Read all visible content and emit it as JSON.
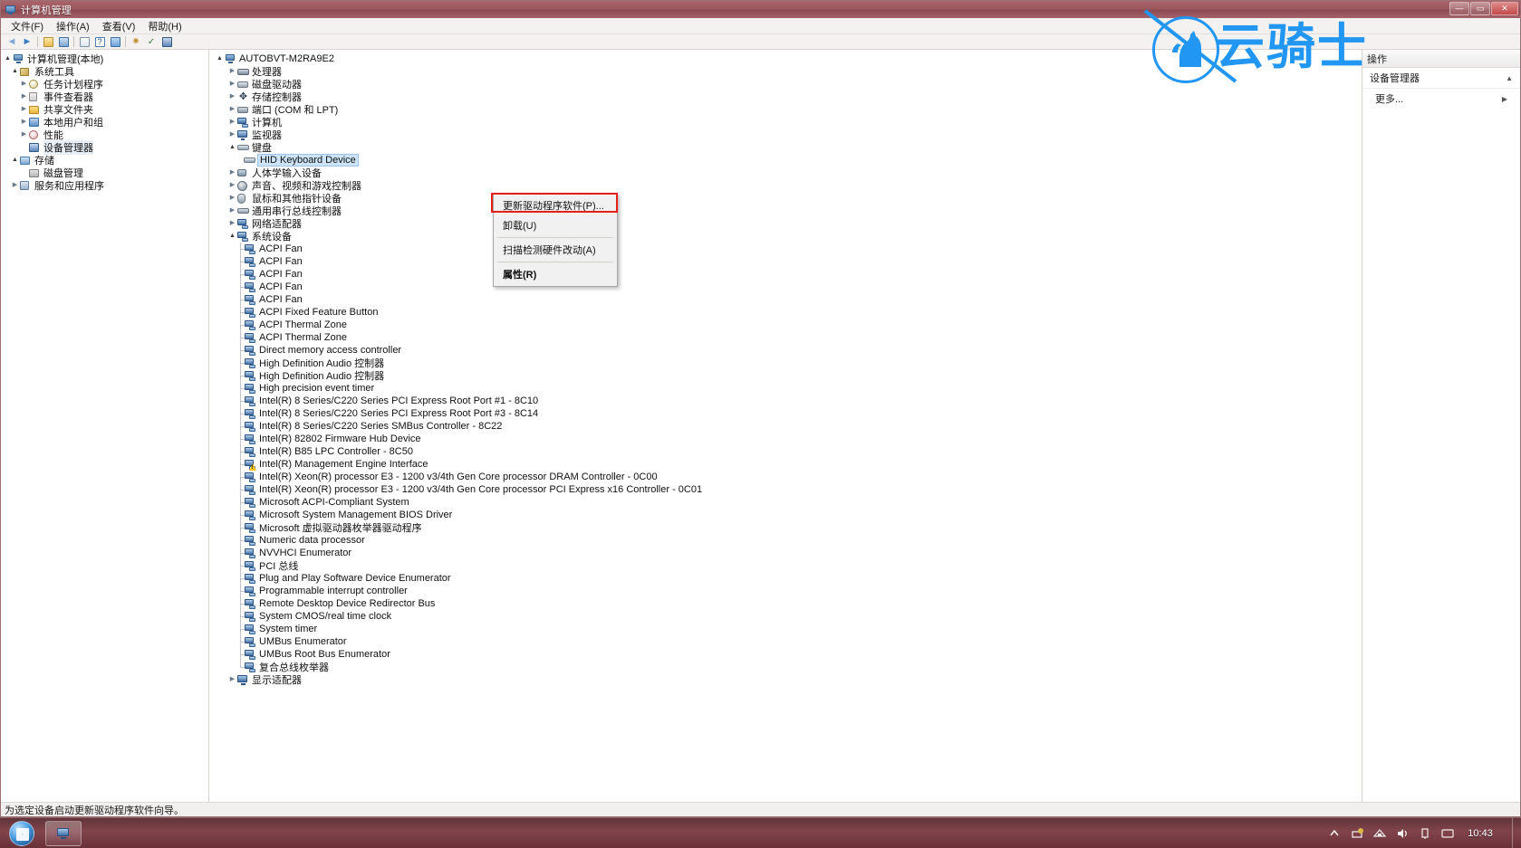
{
  "window": {
    "title": "计算机管理",
    "icon": "computer-management-icon",
    "controls": {
      "minimize": "—",
      "maximize": "▭",
      "close": "✕"
    }
  },
  "menu_bar": {
    "items": [
      {
        "label": "文件(F)",
        "name": "menu-file"
      },
      {
        "label": "操作(A)",
        "name": "menu-action"
      },
      {
        "label": "查看(V)",
        "name": "menu-view"
      },
      {
        "label": "帮助(H)",
        "name": "menu-help"
      }
    ]
  },
  "toolbar": {
    "buttons": [
      {
        "name": "back-button",
        "icon": "arrow-left-icon",
        "glyph": "◄"
      },
      {
        "name": "forward-button",
        "icon": "arrow-right-icon",
        "glyph": "►"
      },
      {
        "name": "up-one-level-button",
        "icon": "folder-up-icon",
        "glyph": ""
      },
      {
        "name": "show-hide-tree-button",
        "icon": "tree-pane-icon",
        "glyph": ""
      },
      {
        "name": "export-list-button",
        "icon": "export-list-icon",
        "glyph": ""
      },
      {
        "name": "help-button",
        "icon": "question-icon",
        "glyph": "?"
      },
      {
        "name": "properties-button",
        "icon": "properties-icon",
        "glyph": ""
      },
      {
        "name": "refresh-button",
        "icon": "refresh-icon",
        "glyph": ""
      },
      {
        "name": "scan-hardware-button",
        "icon": "scan-hardware-icon",
        "glyph": ""
      },
      {
        "name": "update-driver-button",
        "icon": "update-driver-icon",
        "glyph": ""
      }
    ]
  },
  "left_tree": {
    "items": [
      {
        "label": "计算机管理(本地)",
        "indent": 0,
        "twisty": "▲",
        "icon": "computer-icon"
      },
      {
        "label": "系统工具",
        "indent": 1,
        "twisty": "▲",
        "icon": "tools-icon"
      },
      {
        "label": "任务计划程序",
        "indent": 2,
        "twisty": "▶",
        "icon": "task-scheduler-icon"
      },
      {
        "label": "事件查看器",
        "indent": 2,
        "twisty": "▶",
        "icon": "event-viewer-icon"
      },
      {
        "label": "共享文件夹",
        "indent": 2,
        "twisty": "▶",
        "icon": "shared-folders-icon"
      },
      {
        "label": "本地用户和组",
        "indent": 2,
        "twisty": "▶",
        "icon": "local-users-groups-icon"
      },
      {
        "label": "性能",
        "indent": 2,
        "twisty": "▶",
        "icon": "performance-icon"
      },
      {
        "label": "设备管理器",
        "indent": 2,
        "twisty": "",
        "icon": "device-manager-icon",
        "selected": true
      },
      {
        "label": "存储",
        "indent": 1,
        "twisty": "▲",
        "icon": "storage-icon"
      },
      {
        "label": "磁盘管理",
        "indent": 2,
        "twisty": "",
        "icon": "disk-management-icon"
      },
      {
        "label": "服务和应用程序",
        "indent": 1,
        "twisty": "▶",
        "icon": "services-apps-icon"
      }
    ]
  },
  "device_tree": {
    "root": {
      "label": "AUTOBVT-M2RA9E2",
      "twisty": "▲",
      "icon": "computer-icon"
    },
    "categories": [
      {
        "label": "处理器",
        "twisty": "▶",
        "icon": "processor-icon"
      },
      {
        "label": "磁盘驱动器",
        "twisty": "▶",
        "icon": "disk-drive-icon"
      },
      {
        "label": "存储控制器",
        "twisty": "▶",
        "icon": "storage-controller-icon"
      },
      {
        "label": "端口 (COM 和 LPT)",
        "twisty": "▶",
        "icon": "ports-icon"
      },
      {
        "label": "计算机",
        "twisty": "▶",
        "icon": "computer-category-icon"
      },
      {
        "label": "监视器",
        "twisty": "▶",
        "icon": "monitor-icon"
      },
      {
        "label": "键盘",
        "twisty": "▲",
        "icon": "keyboard-icon"
      }
    ],
    "keyboard_child": {
      "label": "HID Keyboard Device",
      "icon": "hid-keyboard-icon",
      "selected": true
    },
    "categories_after": [
      {
        "label": "人体学输入设备",
        "twisty": "▶",
        "icon": "hid-icon"
      },
      {
        "label": "声音、视频和游戏控制器",
        "twisty": "▶",
        "icon": "sound-icon"
      },
      {
        "label": "鼠标和其他指针设备",
        "twisty": "▶",
        "icon": "mouse-icon"
      },
      {
        "label": "通用串行总线控制器",
        "twisty": "▶",
        "icon": "usb-icon"
      },
      {
        "label": "网络适配器",
        "twisty": "▶",
        "icon": "network-adapter-icon"
      }
    ],
    "system_devices_label": "系统设备",
    "system_devices_twisty": "▲",
    "system_devices": [
      {
        "label": "ACPI Fan"
      },
      {
        "label": "ACPI Fan"
      },
      {
        "label": "ACPI Fan"
      },
      {
        "label": "ACPI Fan"
      },
      {
        "label": "ACPI Fan"
      },
      {
        "label": "ACPI Fixed Feature Button"
      },
      {
        "label": "ACPI Thermal Zone"
      },
      {
        "label": "ACPI Thermal Zone"
      },
      {
        "label": "Direct memory access controller"
      },
      {
        "label": "High Definition Audio 控制器"
      },
      {
        "label": "High Definition Audio 控制器"
      },
      {
        "label": "High precision event timer"
      },
      {
        "label": "Intel(R) 8 Series/C220 Series PCI Express Root Port #1 - 8C10"
      },
      {
        "label": "Intel(R) 8 Series/C220 Series PCI Express Root Port #3 - 8C14"
      },
      {
        "label": "Intel(R) 8 Series/C220 Series SMBus Controller - 8C22"
      },
      {
        "label": "Intel(R) 82802 Firmware Hub Device"
      },
      {
        "label": "Intel(R) B85 LPC Controller - 8C50"
      },
      {
        "label": "Intel(R) Management Engine Interface",
        "warning": true
      },
      {
        "label": "Intel(R) Xeon(R) processor E3 - 1200 v3/4th Gen Core processor DRAM Controller - 0C00"
      },
      {
        "label": "Intel(R) Xeon(R) processor E3 - 1200 v3/4th Gen Core processor PCI Express x16 Controller - 0C01"
      },
      {
        "label": "Microsoft ACPI-Compliant System"
      },
      {
        "label": "Microsoft System Management BIOS Driver"
      },
      {
        "label": "Microsoft 虚拟驱动器枚举器驱动程序"
      },
      {
        "label": "Numeric data processor"
      },
      {
        "label": "NVVHCI Enumerator"
      },
      {
        "label": "PCI 总线"
      },
      {
        "label": "Plug and Play Software Device Enumerator"
      },
      {
        "label": "Programmable interrupt controller"
      },
      {
        "label": "Remote Desktop Device Redirector Bus"
      },
      {
        "label": "System CMOS/real time clock"
      },
      {
        "label": "System timer"
      },
      {
        "label": "UMBus Enumerator"
      },
      {
        "label": "UMBus Root Bus Enumerator"
      },
      {
        "label": "复合总线枚举器"
      }
    ],
    "trailing_category": {
      "label": "显示适配器",
      "twisty": "▶",
      "icon": "display-adapter-icon"
    }
  },
  "context_menu": {
    "items": [
      {
        "label": "更新驱动程序软件(P)...",
        "name": "menu-update-driver",
        "highlighted": true
      },
      {
        "label": "卸载(U)",
        "name": "menu-uninstall"
      },
      {
        "label": "扫描检测硬件改动(A)",
        "name": "menu-scan-hardware"
      },
      {
        "label": "属性(R)",
        "name": "menu-properties",
        "bold": true
      }
    ],
    "highlight_color": "#e32119"
  },
  "actions_pane": {
    "title": "操作",
    "groups": [
      {
        "label": "设备管理器",
        "caret": "▲"
      },
      {
        "label": "更多...",
        "caret": "▶"
      }
    ]
  },
  "status_bar": {
    "text": "为选定设备启动更新驱动程序软件向导。"
  },
  "watermark": {
    "text": "云骑士",
    "color": "#2196f3"
  },
  "taskbar": {
    "start_label": "",
    "tasks": [
      {
        "name": "taskbar-computer-management",
        "label": ""
      }
    ],
    "clock": "10:43",
    "tray_icons": [
      "show-hidden-icons",
      "action-center-icon",
      "network-icon",
      "volume-icon",
      "usb-icon",
      "language-icon"
    ]
  }
}
